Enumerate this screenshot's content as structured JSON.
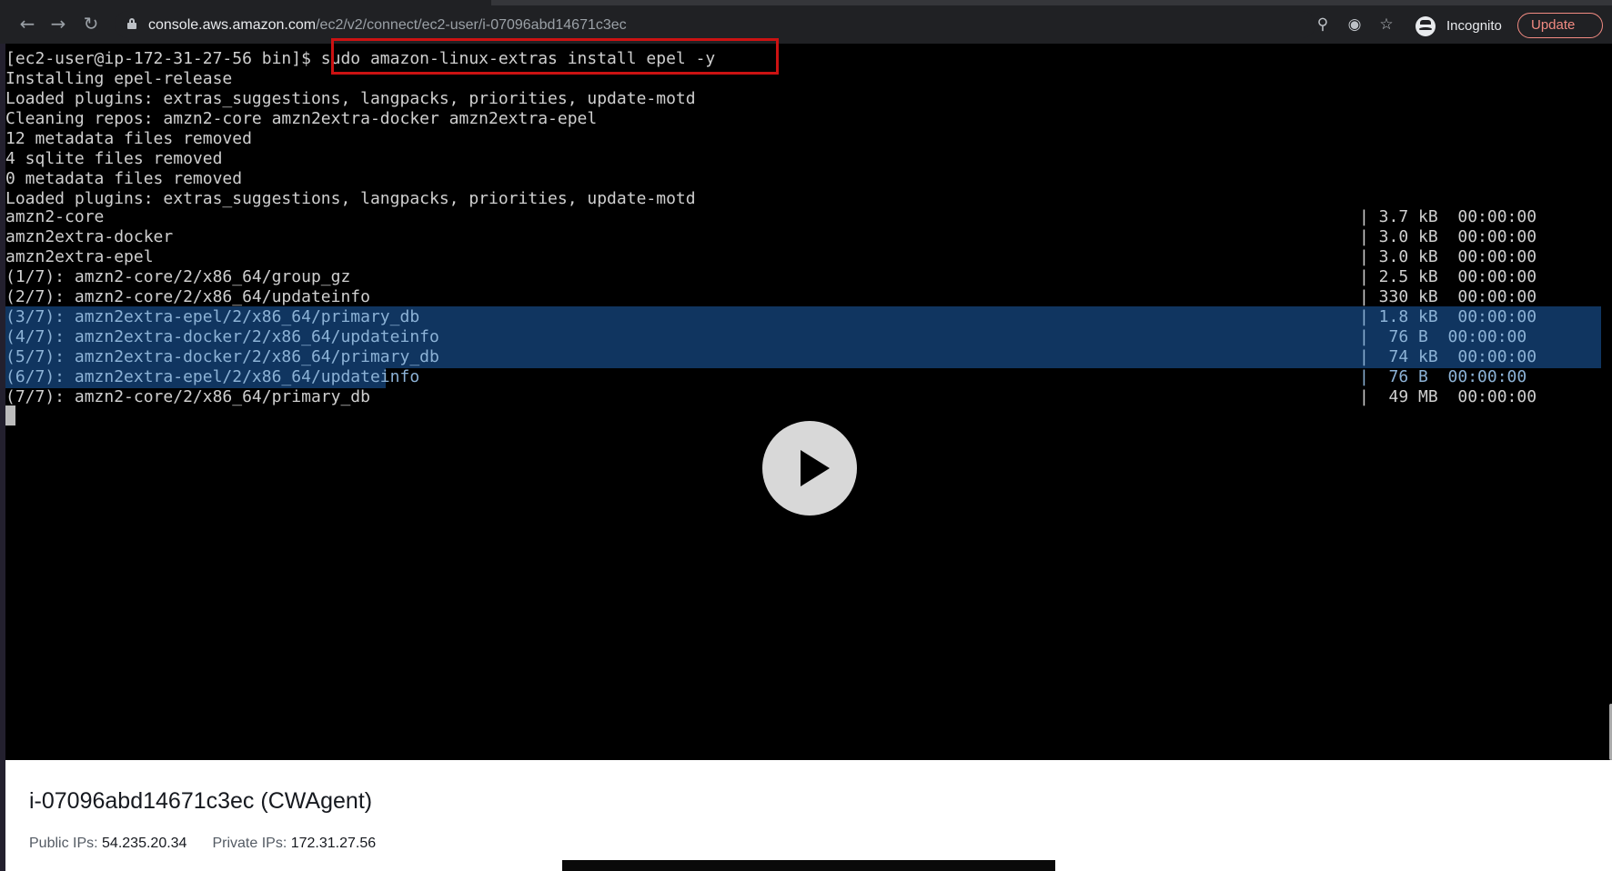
{
  "browser": {
    "url_host": "console.aws.amazon.com",
    "url_path": "/ec2/v2/connect/ec2-user/i-07096abd14671c3ec",
    "icons": {
      "back": "arrow-left-icon",
      "forward": "arrow-right-icon",
      "reload": "reload-icon",
      "lock": "lock-icon",
      "zoom": "zoom-icon",
      "tracking": "eye-off-icon",
      "bookmark": "star-icon",
      "incognito": "incognito-icon"
    },
    "incognito_label": "Incognito",
    "update_label": "Update"
  },
  "terminal": {
    "prompt": "[ec2-user@ip-172-31-27-56 bin]$ ",
    "command": "sudo amazon-linux-extras install epel -y",
    "lines": [
      "Installing epel-release",
      "Loaded plugins: extras_suggestions, langpacks, priorities, update-motd",
      "Cleaning repos: amzn2-core amzn2extra-docker amzn2extra-epel",
      "12 metadata files removed",
      "4 sqlite files removed",
      "0 metadata files removed",
      "Loaded plugins: extras_suggestions, langpacks, priorities, update-motd"
    ],
    "repo_rows": [
      {
        "name": "amzn2-core",
        "size": "| 3.7 kB  00:00:00"
      },
      {
        "name": "amzn2extra-docker",
        "size": "| 3.0 kB  00:00:00"
      },
      {
        "name": "amzn2extra-epel",
        "size": "| 3.0 kB  00:00:00"
      },
      {
        "name": "(1/7): amzn2-core/2/x86_64/group_gz",
        "size": "| 2.5 kB  00:00:00"
      },
      {
        "name": "(2/7): amzn2-core/2/x86_64/updateinfo",
        "size": "| 330 kB  00:00:00"
      },
      {
        "name": "(3/7): amzn2extra-epel/2/x86_64/primary_db",
        "size": "| 1.8 kB  00:00:00"
      },
      {
        "name": "(4/7): amzn2extra-docker/2/x86_64/updateinfo",
        "size": "|  76 B  00:00:00"
      },
      {
        "name": "(5/7): amzn2extra-docker/2/x86_64/primary_db",
        "size": "|  74 kB  00:00:00"
      },
      {
        "name": "(6/7): amzn2extra-epel/2/x86_64/updateinfo",
        "size": "|  76 B  00:00:00"
      },
      {
        "name": "(7/7): amzn2-core/2/x86_64/primary_db",
        "size": "|  49 MB  00:00:00"
      }
    ]
  },
  "player": {
    "play_icon": "play-icon"
  },
  "instance": {
    "title": "i-07096abd14671c3ec (CWAgent)",
    "public_label": "Public IPs: ",
    "public_ip": "54.235.20.34",
    "private_label": "Private IPs: ",
    "private_ip": "172.31.27.56"
  },
  "colors": {
    "terminal_bg": "#000000",
    "terminal_text": "#cfcfcf",
    "selection_bg": "#103560",
    "command_box": "#cc1212",
    "update_accent": "#f28b82"
  }
}
